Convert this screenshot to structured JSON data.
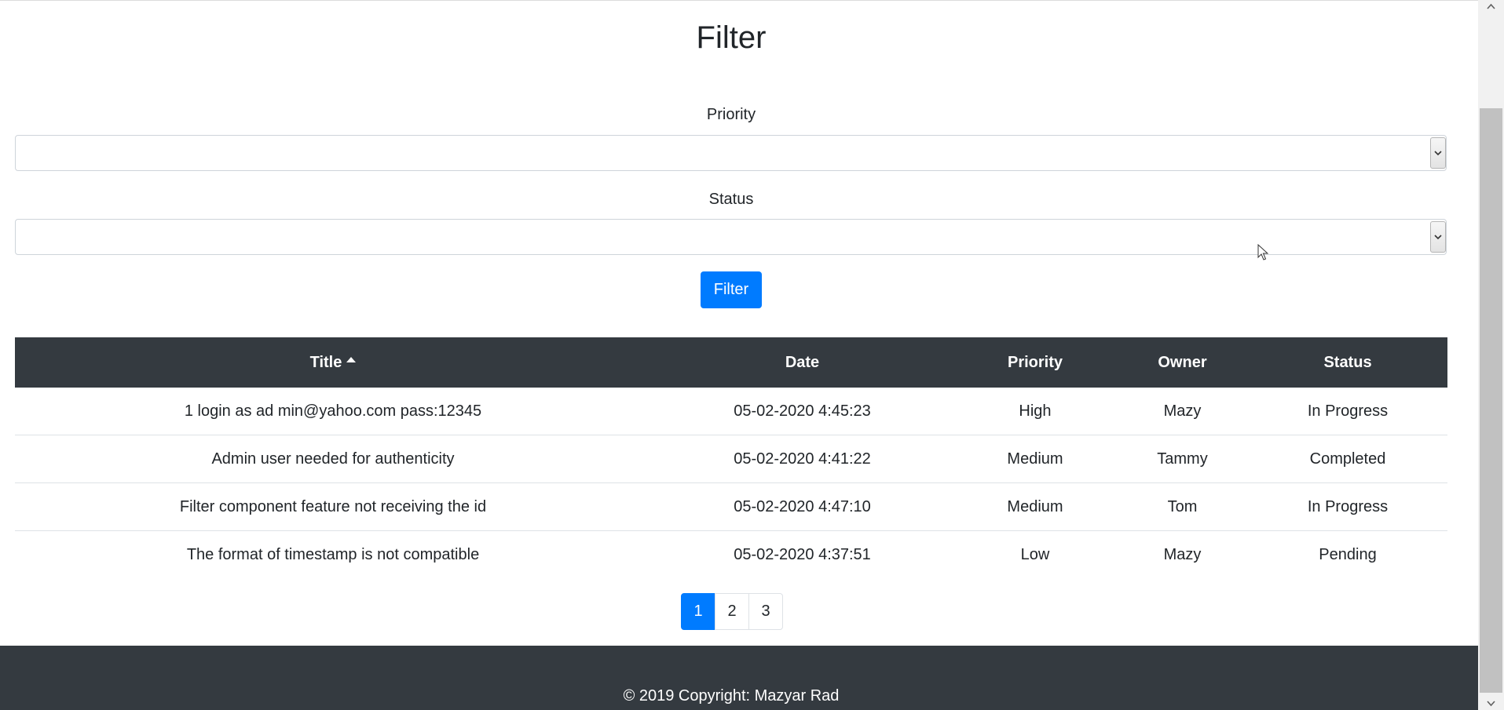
{
  "header": {
    "title": "Filter"
  },
  "form": {
    "priority_label": "Priority",
    "priority_value": "",
    "status_label": "Status",
    "status_value": "",
    "filter_button": "Filter"
  },
  "table": {
    "columns": [
      "Title",
      "Date",
      "Priority",
      "Owner",
      "Status"
    ],
    "sort_column": "Title",
    "sort_direction": "ascending",
    "rows": [
      [
        "1 login as ad min@yahoo.com pass:12345",
        "05-02-2020 4:45:23",
        "High",
        "Mazy",
        "In Progress"
      ],
      [
        "Admin user needed for authenticity",
        "05-02-2020 4:41:22",
        "Medium",
        "Tammy",
        "Completed"
      ],
      [
        "Filter component feature not receiving the id",
        "05-02-2020 4:47:10",
        "Medium",
        "Tom",
        "In Progress"
      ],
      [
        "The format of timestamp is not compatible",
        "05-02-2020 4:37:51",
        "Low",
        "Mazy",
        "Pending"
      ]
    ]
  },
  "pagination": {
    "pages": [
      "1",
      "2",
      "3"
    ],
    "active": "1"
  },
  "footer": {
    "text": "© 2019 Copyright: Mazyar Rad"
  },
  "colors": {
    "primary": "#007bff",
    "dark": "#343a40",
    "border": "#dee2e6"
  }
}
